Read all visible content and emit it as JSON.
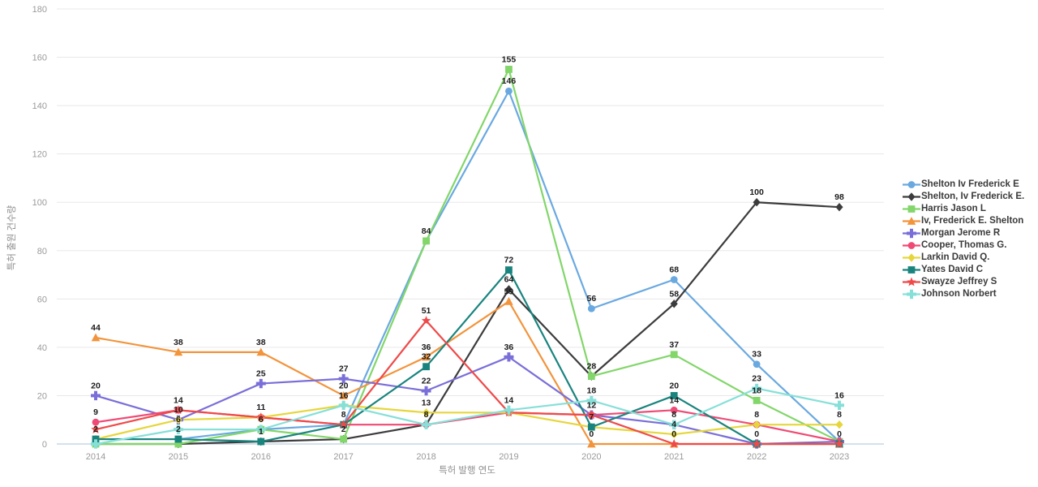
{
  "chart_data": {
    "type": "line",
    "title": "",
    "xlabel": "특허 발행 연도",
    "ylabel": "특허 출원 건수량",
    "categories": [
      "2014",
      "2015",
      "2016",
      "2017",
      "2018",
      "2019",
      "2020",
      "2021",
      "2022",
      "2023"
    ],
    "yticks": [
      0,
      20,
      40,
      60,
      80,
      100,
      120,
      140,
      160,
      180
    ],
    "ylim": [
      0,
      180
    ],
    "grid": true,
    "legend_position": "right",
    "series": [
      {
        "name": "Shelton Iv Frederick E",
        "color": "#6aa9e0",
        "marker": "circle",
        "values": [
          2,
          2,
          6,
          8,
          84,
          146,
          56,
          68,
          33,
          1
        ]
      },
      {
        "name": "Shelton, Iv Frederick E.",
        "color": "#3c3c3c",
        "marker": "diamond",
        "values": [
          0,
          0,
          1,
          2,
          8,
          64,
          28,
          58,
          100,
          98
        ]
      },
      {
        "name": "Harris Jason L",
        "color": "#82d66a",
        "marker": "square",
        "values": [
          0,
          0,
          6,
          2,
          84,
          155,
          28,
          37,
          18,
          1
        ]
      },
      {
        "name": "Iv, Frederick E. Shelton",
        "color": "#f2943c",
        "marker": "triangle",
        "values": [
          44,
          38,
          38,
          20,
          36,
          59,
          0,
          0,
          0,
          0
        ]
      },
      {
        "name": "Morgan Jerome R",
        "color": "#7a6fd8",
        "marker": "cross",
        "values": [
          20,
          10,
          25,
          27,
          22,
          36,
          12,
          8,
          0,
          1
        ]
      },
      {
        "name": "Cooper, Thomas G.",
        "color": "#ef4a75",
        "marker": "circle",
        "values": [
          9,
          14,
          11,
          8,
          8,
          13,
          12,
          14,
          8,
          1
        ]
      },
      {
        "name": "Larkin David Q.",
        "color": "#e6d63c",
        "marker": "diamond",
        "values": [
          2,
          10,
          11,
          16,
          13,
          13,
          7,
          4,
          8,
          8
        ]
      },
      {
        "name": "Yates David C",
        "color": "#19847e",
        "marker": "square",
        "values": [
          2,
          2,
          1,
          8,
          32,
          72,
          7,
          20,
          0,
          0
        ]
      },
      {
        "name": "Swayze Jeffrey S",
        "color": "#ef4a4a",
        "marker": "star",
        "values": [
          6,
          14,
          11,
          8,
          51,
          13,
          12,
          0,
          0,
          0
        ]
      },
      {
        "name": "Johnson Norbert",
        "color": "#86e0d8",
        "marker": "cross",
        "values": [
          0,
          6,
          6,
          16,
          8,
          14,
          18,
          8,
          23,
          16
        ]
      }
    ],
    "point_labels": [
      {
        "x": "2014",
        "y": 44,
        "text": "44"
      },
      {
        "x": "2014",
        "y": 20,
        "text": "20"
      },
      {
        "x": "2014",
        "y": 9,
        "text": "9"
      },
      {
        "x": "2014",
        "y": 2,
        "text": "2"
      },
      {
        "x": "2015",
        "y": 38,
        "text": "38"
      },
      {
        "x": "2015",
        "y": 14,
        "text": "14"
      },
      {
        "x": "2015",
        "y": 10,
        "text": "10"
      },
      {
        "x": "2015",
        "y": 6,
        "text": "6"
      },
      {
        "x": "2015",
        "y": 2,
        "text": "2"
      },
      {
        "x": "2016",
        "y": 38,
        "text": "38"
      },
      {
        "x": "2016",
        "y": 25,
        "text": "25"
      },
      {
        "x": "2016",
        "y": 11,
        "text": "11"
      },
      {
        "x": "2016",
        "y": 6,
        "text": "6"
      },
      {
        "x": "2016",
        "y": 1,
        "text": "1"
      },
      {
        "x": "2017",
        "y": 27,
        "text": "27"
      },
      {
        "x": "2017",
        "y": 20,
        "text": "20"
      },
      {
        "x": "2017",
        "y": 16,
        "text": "16"
      },
      {
        "x": "2017",
        "y": 8,
        "text": "8"
      },
      {
        "x": "2017",
        "y": 2,
        "text": "2"
      },
      {
        "x": "2018",
        "y": 84,
        "text": "84"
      },
      {
        "x": "2018",
        "y": 51,
        "text": "51"
      },
      {
        "x": "2018",
        "y": 36,
        "text": "36"
      },
      {
        "x": "2018",
        "y": 32,
        "text": "32"
      },
      {
        "x": "2018",
        "y": 22,
        "text": "22"
      },
      {
        "x": "2018",
        "y": 13,
        "text": "13"
      },
      {
        "x": "2018",
        "y": 8,
        "text": "8"
      },
      {
        "x": "2019",
        "y": 155,
        "text": "155"
      },
      {
        "x": "2019",
        "y": 146,
        "text": "146"
      },
      {
        "x": "2019",
        "y": 72,
        "text": "72"
      },
      {
        "x": "2019",
        "y": 64,
        "text": "64"
      },
      {
        "x": "2019",
        "y": 59,
        "text": "59"
      },
      {
        "x": "2019",
        "y": 36,
        "text": "36"
      },
      {
        "x": "2019",
        "y": 14,
        "text": "14"
      },
      {
        "x": "2020",
        "y": 56,
        "text": "56"
      },
      {
        "x": "2020",
        "y": 28,
        "text": "28"
      },
      {
        "x": "2020",
        "y": 18,
        "text": "18"
      },
      {
        "x": "2020",
        "y": 12,
        "text": "12"
      },
      {
        "x": "2020",
        "y": 7,
        "text": "7"
      },
      {
        "x": "2020",
        "y": 0,
        "text": "0"
      },
      {
        "x": "2021",
        "y": 68,
        "text": "68"
      },
      {
        "x": "2021",
        "y": 58,
        "text": "58"
      },
      {
        "x": "2021",
        "y": 37,
        "text": "37"
      },
      {
        "x": "2021",
        "y": 20,
        "text": "20"
      },
      {
        "x": "2021",
        "y": 14,
        "text": "14"
      },
      {
        "x": "2021",
        "y": 8,
        "text": "8"
      },
      {
        "x": "2021",
        "y": 4,
        "text": "4"
      },
      {
        "x": "2021",
        "y": 0,
        "text": "0"
      },
      {
        "x": "2022",
        "y": 100,
        "text": "100"
      },
      {
        "x": "2022",
        "y": 33,
        "text": "33"
      },
      {
        "x": "2022",
        "y": 23,
        "text": "23"
      },
      {
        "x": "2022",
        "y": 18,
        "text": "18"
      },
      {
        "x": "2022",
        "y": 8,
        "text": "8"
      },
      {
        "x": "2022",
        "y": 0,
        "text": "0"
      },
      {
        "x": "2023",
        "y": 98,
        "text": "98"
      },
      {
        "x": "2023",
        "y": 16,
        "text": "16"
      },
      {
        "x": "2023",
        "y": 8,
        "text": "8"
      },
      {
        "x": "2023",
        "y": 0,
        "text": "0"
      }
    ]
  }
}
